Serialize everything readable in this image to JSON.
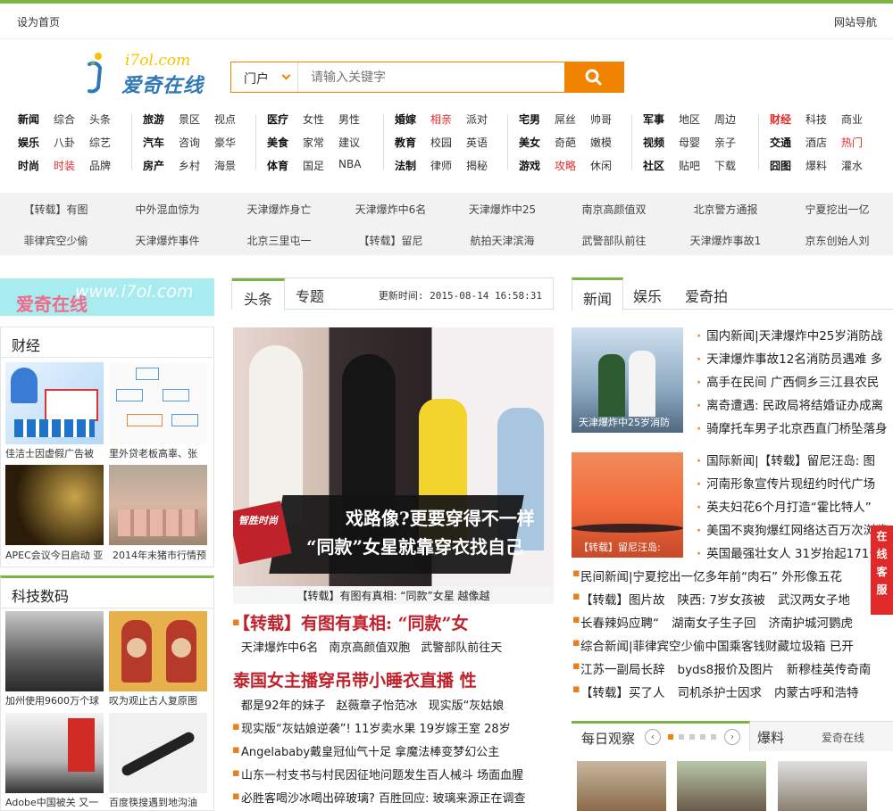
{
  "topbar": {
    "left": "设为首页",
    "right": "网站导航"
  },
  "logo": {
    "url_text": "i7ol.com",
    "cn_text": "爱奇在线"
  },
  "search": {
    "scope": "门户",
    "placeholder": "请输入关键字"
  },
  "nav": [
    [
      [
        "新闻",
        "综合",
        "头条"
      ],
      [
        "娱乐",
        "八卦",
        "综艺"
      ],
      [
        "时尚",
        "时装",
        "品牌"
      ]
    ],
    [
      [
        "旅游",
        "景区",
        "视点"
      ],
      [
        "汽车",
        "咨询",
        "豪华"
      ],
      [
        "房产",
        "乡村",
        "海景"
      ]
    ],
    [
      [
        "医疗",
        "女性",
        "男性"
      ],
      [
        "美食",
        "家常",
        "建议"
      ],
      [
        "体育",
        "国足",
        "NBA"
      ]
    ],
    [
      [
        "婚嫁",
        "相亲",
        "派对"
      ],
      [
        "教育",
        "校园",
        "英语"
      ],
      [
        "法制",
        "律师",
        "揭秘"
      ]
    ],
    [
      [
        "宅男",
        "屌丝",
        "帅哥"
      ],
      [
        "美女",
        "奇葩",
        "嫩模"
      ],
      [
        "游戏",
        "攻略",
        "休闲"
      ]
    ],
    [
      [
        "军事",
        "地区",
        "周边"
      ],
      [
        "视频",
        "母婴",
        "亲子"
      ],
      [
        "社区",
        "贴吧",
        "下载"
      ]
    ],
    [
      [
        "财经",
        "科技",
        "商业"
      ],
      [
        "交通",
        "酒店",
        "热门"
      ],
      [
        "囧图",
        "爆料",
        "灌水"
      ]
    ]
  ],
  "hotwords": [
    [
      "【转载】有图",
      "中外混血惊为",
      "天津爆炸身亡",
      "天津爆炸中6名",
      "天津爆炸中25",
      "南京高颜值双",
      "北京警方通报",
      "宁夏挖出一亿"
    ],
    [
      "菲律宾空少偷",
      "天津爆炸事件",
      "北京三里屯一",
      "【转载】留尼",
      "航拍天津滨海",
      "武警部队前往",
      "天津爆炸事故1",
      "京东创始人刘"
    ]
  ],
  "banner": {
    "cn": "爱奇在线",
    "url": "www.i7ol.com"
  },
  "finance": {
    "title": "财经",
    "captions": [
      "佳洁士因虚假广告被",
      "里外贷老板高辜、张",
      "APEC会议今日启动 亚",
      "2014年末猪市行情预"
    ]
  },
  "tech": {
    "title": "科技数码",
    "captions": [
      "加州使用9600万个球",
      "叹为观止古人复原图",
      "Adobe中国被关 又一",
      "百度筷搜遇到地沟油"
    ]
  },
  "mid": {
    "tabs": [
      "头条",
      "专题"
    ],
    "updated": "更新时间: 2015-08-14 16:58:31",
    "img_title1": "戏路像?更要穿得不一样",
    "img_title2": "“同款”女星就靠穿衣找自己",
    "img_tag": "智胜时尚",
    "caption": "【转载】有图有真相: “同款”女星 越像越",
    "headline1": "【转载】有图有真相: “同款”女",
    "sub1": [
      "天津爆炸中6名",
      "南京高颜值双胞",
      "武警部队前往天"
    ],
    "headline2": "泰国女主播穿吊带小睡衣直播 性",
    "sub2": [
      "都是92年的妹子",
      "赵薇章子怡范冰",
      "现实版“灰姑娘"
    ],
    "list": [
      "现实版“灰姑娘逆袭”! 11岁卖水果 19岁嫁王室 28岁",
      "Angelababy戴皇冠仙气十足 拿魔法棒变梦幻公主",
      "山东一村支书与村民因征地问题发生百人械斗 场面血腥",
      "必胜客喝沙冰喝出碎玻璃? 百胜回应: 玻璃来源正在调查"
    ]
  },
  "right": {
    "tabs": [
      "新闻",
      "娱乐",
      "爱奇拍"
    ],
    "img1_caption": "天津爆炸中25岁消防",
    "img2_caption": "【转载】留尼汪岛:",
    "list1": [
      "国内新闻|天津爆炸中25岁消防战",
      "天津爆炸事故12名消防员遇难 多",
      "高手在民间 广西侗乡三江县农民",
      "离奇遭遇: 民政局将结婚证办成离",
      "骑摩托车男子北京西直门桥坠落身"
    ],
    "list2": [
      "国际新闻|【转载】留尼汪岛: 图",
      "河南形象宣传片现纽约时代广场",
      "英夫妇花6个月打造“霍比特人”",
      "美国不爽狗爆红网络达百万次浏览",
      "英国最强壮女人 31岁抬起171公斤"
    ],
    "rows": [
      [
        "民间新闻|宁夏挖出一亿多年前“肉石” 外形像五花"
      ],
      [
        "【转载】图片故",
        "陕西: 7岁女孩被",
        "武汉两女子地"
      ],
      [
        "长春辣妈应聘“",
        "湖南女子生子回",
        "济南护城河鹦虎"
      ],
      [
        "综合新闻|菲律宾空少偷中国乘客钱财藏垃圾箱 已开"
      ],
      [
        "江苏一副局长辞",
        "byds8报价及图片",
        "新穆桂英传奇南"
      ],
      [
        "【转载】买了人",
        "司机杀护士因求",
        "内蒙古呼和浩特"
      ]
    ]
  },
  "daily": {
    "title": "每日观察",
    "tab2": "爆料",
    "tab3": "爱奇在线"
  },
  "float_text": "在线客服",
  "colors": {
    "accent_green": "#7cb342",
    "orange": "#f08400",
    "red": "#e02a2a",
    "headline": "#c0222b"
  }
}
